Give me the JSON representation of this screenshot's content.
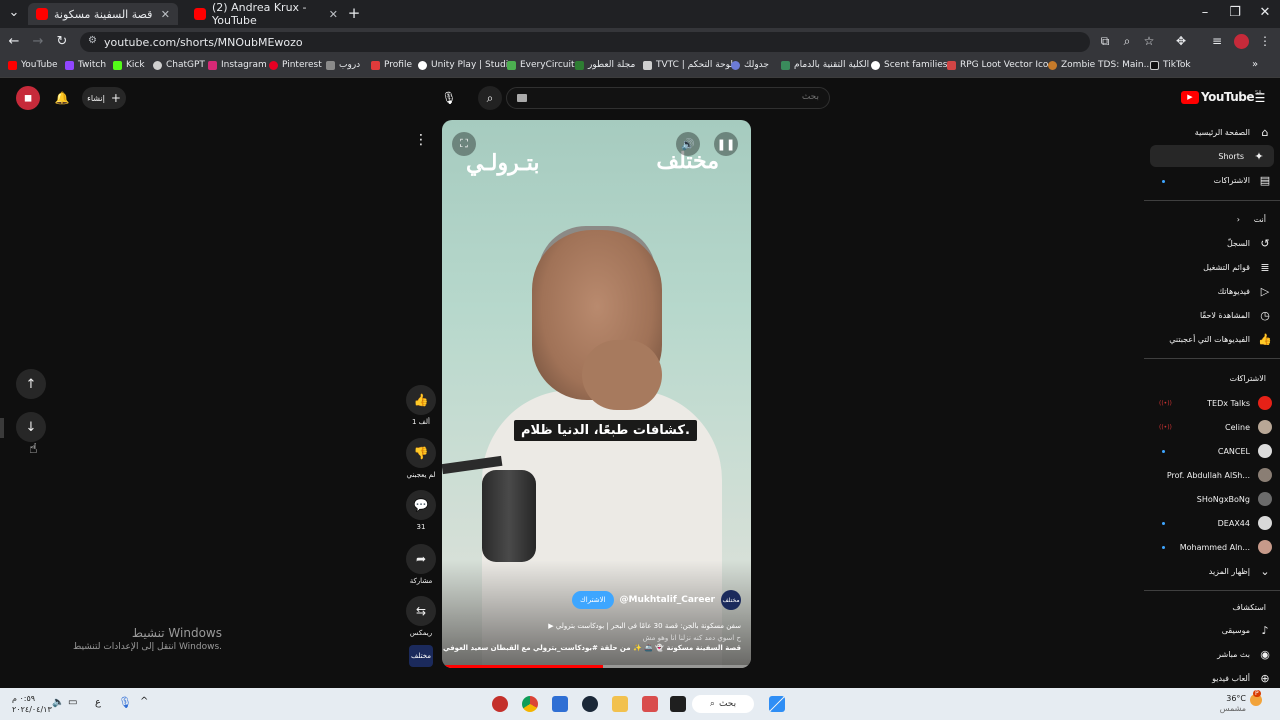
{
  "browser": {
    "tabs": [
      {
        "title": "قصة السفينة مسكونة",
        "active": true
      },
      {
        "title": "(2) Andrea Krux - YouTube",
        "active": false
      }
    ],
    "new_tab": "+",
    "url": "youtube.com/shorts/MNOubMEwozo",
    "bookmarks": [
      "YouTube",
      "Twitch",
      "Kick",
      "ChatGPT",
      "Instagram",
      "Pinterest",
      "دروب",
      "Profile",
      "Unity Play | Studio",
      "EveryCircuit",
      "مجلة العطور",
      "TVTC | لوحة التحكم",
      "جدولك",
      "الكلية التقنية بالدمام",
      "Scent families",
      "RPG Loot Vector Ico...",
      "Zombie TDS: Main...",
      "TikTok"
    ]
  },
  "header": {
    "logo": "YouTube",
    "logo_region": "SA",
    "create_label": "إنشاء",
    "search_placeholder": "بحث"
  },
  "sidebar": {
    "main": [
      {
        "label": "الصفحة الرئيسية",
        "icon": "home-icon"
      },
      {
        "label": "Shorts",
        "icon": "shorts-icon",
        "active": true
      },
      {
        "label": "الاشتراكات",
        "icon": "subscriptions-icon"
      }
    ],
    "you_header": "أنت",
    "you": [
      {
        "label": "السجلّ",
        "icon": "history-icon"
      },
      {
        "label": "قوائم التشغيل",
        "icon": "playlist-icon"
      },
      {
        "label": "فيديوهاتك",
        "icon": "video-icon"
      },
      {
        "label": "المشاهدة لاحقًا",
        "icon": "clock-icon"
      },
      {
        "label": "الفيديوهات التي أعجبتني",
        "icon": "like-icon"
      }
    ],
    "subs_header": "الاشتراكات",
    "subscriptions": [
      {
        "label": "TEDx Talks",
        "color": "#e62117",
        "live": true
      },
      {
        "label": "Celine",
        "color": "#b8a796",
        "live": true
      },
      {
        "label": "CANCEL",
        "color": "#dcdcdc"
      },
      {
        "label": "Prof. Abdullah AlSh...",
        "color": "#8a7e74"
      },
      {
        "label": "SHoNgxBoNg",
        "color": "#6b6b6b"
      },
      {
        "label": "DEAX44",
        "color": "#d9d9d9"
      },
      {
        "label": "Mohammed Aln...",
        "color": "#c79a8a"
      }
    ],
    "show_more": "إظهار المزيد",
    "explore_header": "استكشاف",
    "explore": [
      {
        "label": "موسيقى",
        "icon": "music-icon"
      },
      {
        "label": "بث مباشر",
        "icon": "live-icon"
      },
      {
        "label": "ألعاب فيديو",
        "icon": "game-icon"
      }
    ]
  },
  "player": {
    "logo_left": "بتـرولـي",
    "logo_right": "مختلف",
    "caption": "كشافات طبعًا، الدنيا ظلام.",
    "channel_handle": "@Mukhtalif_Career",
    "channel_avatar_text": "مختلف",
    "subscribe_label": "الاشتراك",
    "title_line": "سفن مسكونة بالجن: قصة 30 عامًا في البحر | بودكاست بترولي",
    "desc_line1": "ح اسوي دمد كنه نزلنا انا وهو مش",
    "desc_line2": "قصة السفينة مسكونة 👻 🚢 ✨ من حلقة #بودكاست_بترولي مع القبطان سعيد العوفي",
    "progress": 0.52
  },
  "actions": [
    {
      "name": "like-button",
      "icon": "thumbs-up-icon",
      "glyph": "👍",
      "label": "1 ألف"
    },
    {
      "name": "dislike-button",
      "icon": "thumbs-down-icon",
      "glyph": "👎",
      "label": "لم يعجبني"
    },
    {
      "name": "comments-button",
      "icon": "comment-icon",
      "glyph": "💬",
      "label": "31"
    },
    {
      "name": "share-button",
      "icon": "share-icon",
      "glyph": "➦",
      "label": "مشاركة"
    },
    {
      "name": "remix-button",
      "icon": "remix-icon",
      "glyph": "⇆",
      "label": "ريمكس"
    }
  ],
  "sound_avatar_text": "مختلف",
  "watermark": {
    "line1": "تنشيط Windows",
    "line2": "انتقل إلى الإعدادات لتنشيط Windows."
  },
  "taskbar": {
    "time": "٠:٥٩ م",
    "date": "٢٠٢٤/٠٤/١٣",
    "lang": "ع",
    "search_label": "بحث",
    "weather_temp": "36°C",
    "weather_desc": "مشمس"
  }
}
